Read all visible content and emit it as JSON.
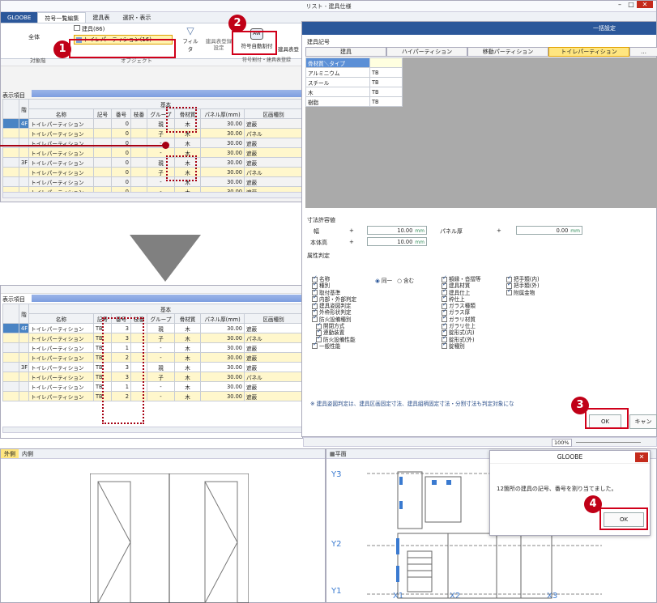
{
  "top_window": {
    "title": "リスト - 建具仕様",
    "tabs": [
      "GLOOBE",
      "符号一覧編集",
      "建具表",
      "選択・表示"
    ],
    "dropdown_item1": "建具(86)",
    "dropdown_item2": "トイレパーティション(16)",
    "label_all": "全体",
    "filter": "フィルタ",
    "btn_fitting_setting": "建具表登録\n設定",
    "btn_auto_numbering": "符号自動割付",
    "btn_fitting_table": "建具表登",
    "group_target": "対象階",
    "group_object": "オブジェクト",
    "group_numbering": "符号割付・建具表登録",
    "display_items": "表示項目",
    "basic_header": "基本",
    "columns": [
      "階",
      "名称",
      "記号",
      "番号",
      "枝番",
      "グループ",
      "骨材質",
      "パネル厚(mm)",
      "区画種別"
    ],
    "rows": [
      {
        "floor": "4F",
        "name": "トイレパーティション",
        "sym": "",
        "no": "0",
        "branch": "",
        "group": "親",
        "mat": "木",
        "thick": "30.00",
        "kind": "遮蔽"
      },
      {
        "floor": "",
        "name": "トイレパーティション",
        "sym": "",
        "no": "0",
        "branch": "",
        "group": "子",
        "mat": "木",
        "thick": "30.00",
        "kind": "パネル"
      },
      {
        "floor": "",
        "name": "トイレパーティション",
        "sym": "",
        "no": "0",
        "branch": "",
        "group": "-",
        "mat": "木",
        "thick": "30.00",
        "kind": "遮蔽"
      },
      {
        "floor": "",
        "name": "トイレパーティション",
        "sym": "",
        "no": "0",
        "branch": "",
        "group": "-",
        "mat": "木",
        "thick": "30.00",
        "kind": "遮蔽"
      },
      {
        "floor": "3F",
        "name": "トイレパーティション",
        "sym": "",
        "no": "0",
        "branch": "",
        "group": "親",
        "mat": "木",
        "thick": "30.00",
        "kind": "遮蔽"
      },
      {
        "floor": "",
        "name": "トイレパーティション",
        "sym": "",
        "no": "0",
        "branch": "",
        "group": "子",
        "mat": "木",
        "thick": "30.00",
        "kind": "パネル"
      },
      {
        "floor": "",
        "name": "トイレパーティション",
        "sym": "",
        "no": "0",
        "branch": "",
        "group": "-",
        "mat": "木",
        "thick": "30.00",
        "kind": "遮蔽"
      },
      {
        "floor": "",
        "name": "トイレパーティション",
        "sym": "",
        "no": "0",
        "branch": "",
        "group": "-",
        "mat": "木",
        "thick": "30.00",
        "kind": "遮蔽"
      }
    ]
  },
  "bottom_grid": {
    "display_items": "表示項目",
    "basic_header": "基本",
    "columns": [
      "階",
      "名称",
      "記号",
      "番号",
      "枝番",
      "グループ",
      "骨材質",
      "パネル厚(mm)",
      "区画種別"
    ],
    "rows": [
      {
        "floor": "4F",
        "name": "トイレパーティション",
        "sym": "TB",
        "no": "3",
        "branch": "",
        "group": "親",
        "mat": "木",
        "thick": "30.00",
        "kind": "遮蔽"
      },
      {
        "floor": "",
        "name": "トイレパーティション",
        "sym": "TB",
        "no": "3",
        "branch": "",
        "group": "子",
        "mat": "木",
        "thick": "30.00",
        "kind": "パネル"
      },
      {
        "floor": "",
        "name": "トイレパーティション",
        "sym": "TB",
        "no": "1",
        "branch": "",
        "group": "-",
        "mat": "木",
        "thick": "30.00",
        "kind": "遮蔽"
      },
      {
        "floor": "",
        "name": "トイレパーティション",
        "sym": "TB",
        "no": "2",
        "branch": "",
        "group": "-",
        "mat": "木",
        "thick": "30.00",
        "kind": "遮蔽"
      },
      {
        "floor": "3F",
        "name": "トイレパーティション",
        "sym": "TB",
        "no": "3",
        "branch": "",
        "group": "親",
        "mat": "木",
        "thick": "30.00",
        "kind": "遮蔽"
      },
      {
        "floor": "",
        "name": "トイレパーティション",
        "sym": "TB",
        "no": "3",
        "branch": "",
        "group": "子",
        "mat": "木",
        "thick": "30.00",
        "kind": "パネル"
      },
      {
        "floor": "",
        "name": "トイレパーティション",
        "sym": "TB",
        "no": "1",
        "branch": "",
        "group": "-",
        "mat": "木",
        "thick": "30.00",
        "kind": "遮蔽"
      },
      {
        "floor": "",
        "name": "トイレパーティション",
        "sym": "TB",
        "no": "2",
        "branch": "",
        "group": "-",
        "mat": "木",
        "thick": "30.00",
        "kind": "遮蔽"
      }
    ]
  },
  "dialog": {
    "title": "一括設定",
    "section_fitting_code": "建具記号",
    "tabs": [
      "建具",
      "ハイパーティション",
      "移動パーティション",
      "トイレパーティション"
    ],
    "tab5": "…",
    "table_header": [
      "骨材質＼タイプ",
      ""
    ],
    "table_rows": [
      [
        "アルミニウム",
        "TB"
      ],
      [
        "スチール",
        "TB"
      ],
      [
        "木",
        "TB"
      ],
      [
        "樹脂",
        "TB"
      ]
    ],
    "section_tolerance": "寸法許容値",
    "width_label": "幅",
    "width_value": "10.00",
    "height_label": "本体高",
    "height_value": "10.00",
    "panel_label": "パネル厚",
    "panel_value": "0.00",
    "plus": "+",
    "unit": "mm",
    "section_attr": "属性判定",
    "radio_same": "同一",
    "radio_contain": "含む",
    "attrs_col1": [
      "名称",
      "種別",
      "取付基準",
      "内部・外部判定",
      "建具姿図判定",
      "外枠形状判定",
      "防火設備種別",
      "開閉方式",
      "連動装置",
      "防火設備性能",
      "一般性能"
    ],
    "attrs_col2": [
      "額縁・沓摺等",
      "建具材質",
      "建具仕上",
      "枠仕上",
      "ガラス種類",
      "ガラス厚",
      "ガラリ材質",
      "ガラリ仕上",
      "錠形式(内)",
      "錠形式(外)",
      "錠種別"
    ],
    "attrs_col3": [
      "把手類(内)",
      "把手類(外)",
      "附属金物"
    ],
    "note": "※ 建具姿図判定は、建具区画固定寸法、建具組柄固定寸法・分割寸法も判定対象にな",
    "ok": "OK",
    "cancel": "キャン",
    "zoom": "100%"
  },
  "bottom_view": {
    "tab_outer": "外側",
    "tab_inner": "内側",
    "plan_label": "平面",
    "grid_y": [
      "Y3",
      "Y2",
      "Y1"
    ],
    "grid_x": [
      "X1",
      "X2",
      "X3"
    ]
  },
  "message": {
    "title": "GLOOBE",
    "text": "12箇所の建具の記号、番号を割り当てました。",
    "ok": "OK"
  },
  "callouts": [
    "1",
    "2",
    "3",
    "4"
  ],
  "colors": {
    "accent": "#2b579a",
    "callout": "#c00017",
    "highlight": "#fff7cc"
  }
}
